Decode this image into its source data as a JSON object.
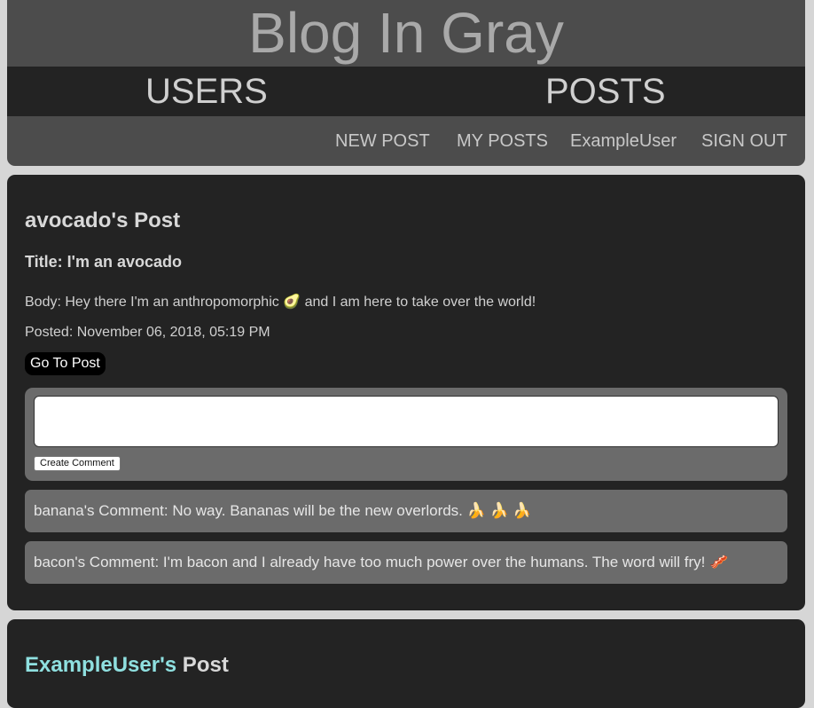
{
  "header": {
    "site_title": "Blog In Gray",
    "main_nav": {
      "users": "USERS",
      "posts": "POSTS"
    },
    "sub_nav": {
      "new_post": "NEW POST",
      "my_posts": "MY POSTS",
      "username": "ExampleUser",
      "sign_out": "SIGN OUT"
    }
  },
  "posts": [
    {
      "heading": "avocado's Post",
      "title": "Title: I'm an avocado",
      "body": "Body: Hey there I'm an anthropomorphic 🥑 and I am here to take over the world!",
      "posted": "Posted: November 06, 2018, 05:19 PM",
      "go_button": "Go To Post",
      "comment_form": {
        "textarea_value": "",
        "button": "Create Comment"
      },
      "comments": [
        {
          "text": "banana's Comment: No way. Bananas will be the new overlords. 🍌 🍌 🍌"
        },
        {
          "text": "bacon's Comment: I'm bacon and I already have too much power over the humans. The word will fry! 🥓"
        }
      ]
    },
    {
      "author": "ExampleUser's",
      "heading_suffix": " Post"
    }
  ],
  "colors": {
    "page_background": "#d6d6d6",
    "header_background": "#4c4c4c",
    "nav_bar": "#232323",
    "card_background": "#232323",
    "comment_background": "#6b6b6b",
    "author_highlight": "#8fe0e0"
  }
}
